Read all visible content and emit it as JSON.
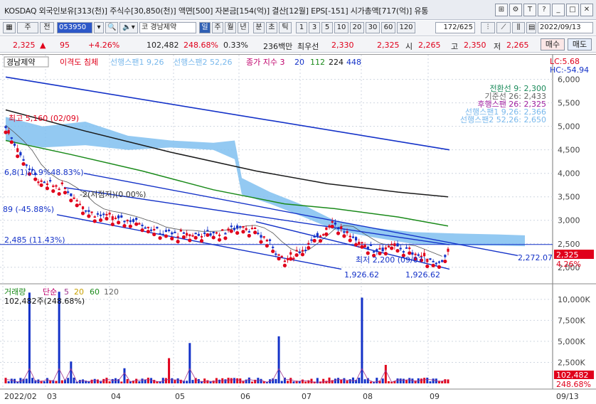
{
  "window": {
    "title": "KOSDAQ 외국인보유[313(천)] 주식수[30,850(천)] 액면[500] 자본금[154(억)] 결산[12월] EPS[-151] 시가총액[717(억)] 유통",
    "btn_min": "_",
    "btn_max": "□",
    "btn_t": "T",
    "btn_help": "?",
    "btn_close": "✕",
    "btn_link": "⊞",
    "btn_gear": "⚙"
  },
  "toolbar": {
    "type_select": "주",
    "type_prev": "전",
    "code": "053950",
    "name_prefix": "코",
    "name": "경남제약",
    "period_day": "일",
    "period_week": "주",
    "period_month": "월",
    "period_year": "년",
    "period_min": "분",
    "period_sec": "초",
    "period_tick": "틱",
    "intervals": [
      "1",
      "3",
      "5",
      "10",
      "20",
      "30",
      "60",
      "120"
    ],
    "count": "172",
    "count_total": "/625",
    "date": "2022/09/13"
  },
  "quote": {
    "price": "2,325",
    "arrow": "▲",
    "change": "95",
    "change_pct": "+4.26%",
    "volume": "102,482",
    "vol_ratio": "248.68%",
    "turnover": "0.33%",
    "amount": "236백만",
    "priority": "최우선",
    "bid": "2,330",
    "ask": "2,325",
    "open_label": "시",
    "open": "2,265",
    "high_label": "고",
    "high": "2,350",
    "low_label": "저",
    "low": "2,265",
    "buy_label": "매수",
    "sell_label": "매도"
  },
  "colors": {
    "candle_up": "#e0001b",
    "candle_down": "#1432c8",
    "cloud": "#80bff0",
    "ma20": "#1a1a1a",
    "ma112": "#1a8a1a",
    "channel": "#1432c8"
  },
  "price_panel": {
    "legend": [
      "경남제약",
      "이격도 침체",
      "선행스팬1 9,26",
      "선행스팬2 52,26",
      "종가 지수 3",
      "20",
      "112",
      "224",
      "448"
    ],
    "right_top": [
      "LC:5.68",
      "HC:-54.94"
    ],
    "info": [
      "전환선 9: 2,300",
      "기준선 26: 2,433",
      "후행스팬 26: 2,325",
      "선행스팬1 9,26: 2,366",
      "선행스팬2 52,26: 2,650"
    ],
    "annotations": {
      "high": "최고 5,160 (02/09)",
      "low": "최저 2,200 (09/07)",
      "level": "2,485 (11.43%)",
      "left1": "6,8(1)(0.9%48.83%)",
      "left2": "89 (-45.88%)",
      "mid": "-2(저점저)(0.00%)",
      "ch1": "1,926.62",
      "ch2": "1,926.62",
      "ch3": "2,272.07"
    },
    "yticks": [
      "6,000",
      "5,500",
      "5,000",
      "4,500",
      "4,000",
      "3,500",
      "3,000",
      "2,500",
      "2,000"
    ],
    "last_price": "2,325",
    "last_pct": "4.26%"
  },
  "volume_panel": {
    "legend": [
      "거래량",
      "단순",
      "5",
      "20",
      "60",
      "120"
    ],
    "info": "102,482주(248.68%)",
    "yticks": [
      "10,000K",
      "7,500K",
      "5,000K",
      "2,500K"
    ],
    "last_vol": "102,482",
    "last_pct": "248.68%"
  },
  "xaxis": {
    "labels": [
      "2022/02",
      "03",
      "04",
      "05",
      "06",
      "07",
      "08",
      "09"
    ],
    "right": "09/13"
  },
  "chart_data": {
    "type": "candlestick",
    "ylim": [
      1800,
      6100
    ],
    "last": 2325,
    "high": 5160,
    "low": 2200,
    "level": 2485
  }
}
